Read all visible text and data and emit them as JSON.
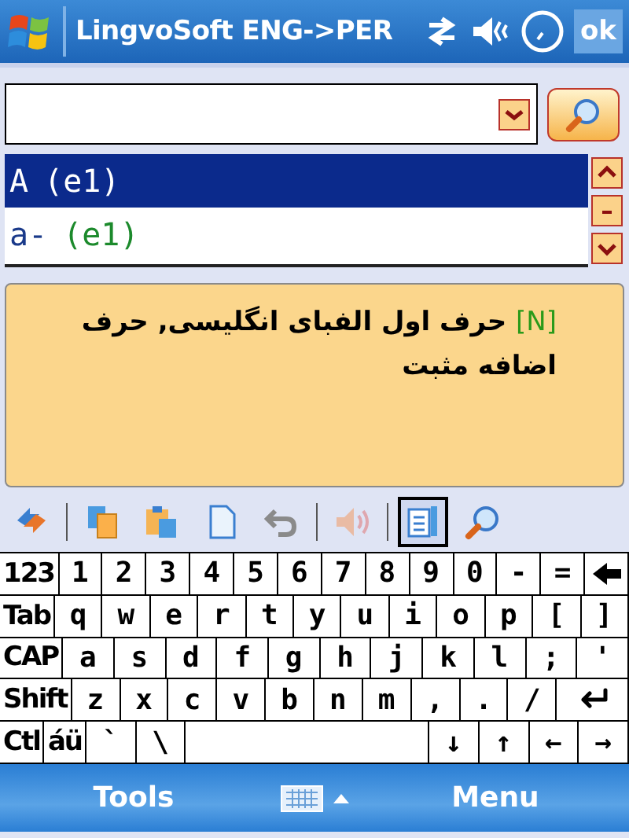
{
  "title_bar": {
    "title": "LingvoSoft ENG->PER",
    "ok": "ok"
  },
  "word_list": [
    {
      "word": "A",
      "tag": "(e1)",
      "selected": true
    },
    {
      "word": "a-",
      "tag": "(e1)",
      "selected": false
    }
  ],
  "translation": {
    "part_of_speech": "[N]",
    "text": "حرف اول الفبای انگلیسی, حرف اضافه مثبت"
  },
  "toolbar": [
    {
      "kind": "swap",
      "selected": false,
      "disabled": false
    },
    {
      "kind": "separator"
    },
    {
      "kind": "copy",
      "selected": false,
      "disabled": false
    },
    {
      "kind": "paste",
      "selected": false,
      "disabled": false
    },
    {
      "kind": "new",
      "selected": false,
      "disabled": false
    },
    {
      "kind": "undo",
      "selected": false,
      "disabled": false
    },
    {
      "kind": "separator"
    },
    {
      "kind": "sound",
      "selected": false,
      "disabled": true
    },
    {
      "kind": "separator"
    },
    {
      "kind": "list",
      "selected": true,
      "disabled": false
    },
    {
      "kind": "search",
      "selected": false,
      "disabled": false
    }
  ],
  "keyboard": [
    [
      {
        "kind": "modifier",
        "label": "123"
      },
      {
        "kind": "key",
        "label": "1"
      },
      {
        "kind": "key",
        "label": "2"
      },
      {
        "kind": "key",
        "label": "3"
      },
      {
        "kind": "key",
        "label": "4"
      },
      {
        "kind": "key",
        "label": "5"
      },
      {
        "kind": "key",
        "label": "6"
      },
      {
        "kind": "key",
        "label": "7"
      },
      {
        "kind": "key",
        "label": "8"
      },
      {
        "kind": "key",
        "label": "9"
      },
      {
        "kind": "key",
        "label": "0"
      },
      {
        "kind": "key",
        "label": "-"
      },
      {
        "kind": "key",
        "label": "="
      },
      {
        "kind": "backspace"
      }
    ],
    [
      {
        "kind": "modifier",
        "label": "Tab"
      },
      {
        "kind": "key",
        "label": "q"
      },
      {
        "kind": "key",
        "label": "w"
      },
      {
        "kind": "key",
        "label": "e"
      },
      {
        "kind": "key",
        "label": "r"
      },
      {
        "kind": "key",
        "label": "t"
      },
      {
        "kind": "key",
        "label": "y"
      },
      {
        "kind": "key",
        "label": "u"
      },
      {
        "kind": "key",
        "label": "i"
      },
      {
        "kind": "key",
        "label": "o"
      },
      {
        "kind": "key",
        "label": "p"
      },
      {
        "kind": "key",
        "label": "["
      },
      {
        "kind": "key",
        "label": "]"
      }
    ],
    [
      {
        "kind": "modifier",
        "label": "CAP"
      },
      {
        "kind": "key",
        "label": "a"
      },
      {
        "kind": "key",
        "label": "s"
      },
      {
        "kind": "key",
        "label": "d"
      },
      {
        "kind": "key",
        "label": "f"
      },
      {
        "kind": "key",
        "label": "g"
      },
      {
        "kind": "key",
        "label": "h"
      },
      {
        "kind": "key",
        "label": "j"
      },
      {
        "kind": "key",
        "label": "k"
      },
      {
        "kind": "key",
        "label": "l"
      },
      {
        "kind": "key",
        "label": ";"
      },
      {
        "kind": "key",
        "label": "'"
      }
    ],
    [
      {
        "kind": "modifier",
        "label": "Shift"
      },
      {
        "kind": "key",
        "label": "z"
      },
      {
        "kind": "key",
        "label": "x"
      },
      {
        "kind": "key",
        "label": "c"
      },
      {
        "kind": "key",
        "label": "v"
      },
      {
        "kind": "key",
        "label": "b"
      },
      {
        "kind": "key",
        "label": "n"
      },
      {
        "kind": "key",
        "label": "m"
      },
      {
        "kind": "key",
        "label": ","
      },
      {
        "kind": "key",
        "label": "."
      },
      {
        "kind": "key",
        "label": "/"
      },
      {
        "kind": "enter"
      }
    ],
    [
      {
        "kind": "modifier",
        "label": "Ctl"
      },
      {
        "kind": "modifier",
        "label": "áü"
      },
      {
        "kind": "key",
        "label": "`"
      },
      {
        "kind": "key",
        "label": "\\"
      },
      {
        "kind": "space"
      },
      {
        "kind": "key",
        "label": "↓"
      },
      {
        "kind": "key",
        "label": "↑"
      },
      {
        "kind": "key",
        "label": "←"
      },
      {
        "kind": "key",
        "label": "→"
      }
    ]
  ],
  "menu_bar": {
    "left": "Tools",
    "right": "Menu"
  }
}
